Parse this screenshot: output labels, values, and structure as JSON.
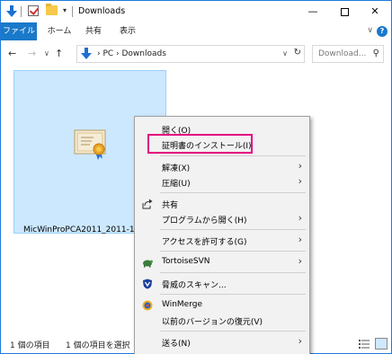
{
  "window": {
    "title": "Downloads",
    "minimize": "—",
    "close": "✕"
  },
  "ribbon": {
    "tabs": [
      "ファイル",
      "ホーム",
      "共有",
      "表示"
    ],
    "expand": "∨",
    "help": "?"
  },
  "nav": {
    "back": "←",
    "forward": "→",
    "recent": "∨",
    "up": "↑",
    "address": "›  PC  ›  Downloads",
    "address_drop": "∨",
    "refresh": "↻",
    "search_placeholder": "Download...",
    "search_icon": "⚲"
  },
  "file": {
    "name": "MicWinProPCA2011_2011-10-"
  },
  "status": {
    "count": "1 個の項目",
    "selected": "1 個の項目を選択"
  },
  "context_menu": {
    "items": [
      {
        "label": "開く(O)"
      },
      {
        "label": "証明書のインストール(I)"
      },
      {
        "label": "解凍(X)",
        "submenu": "›"
      },
      {
        "label": "圧縮(U)",
        "submenu": "›"
      },
      {
        "label": "共有",
        "icon": "share-icon"
      },
      {
        "label": "プログラムから開く(H)",
        "submenu": "›"
      },
      {
        "label": "アクセスを許可する(G)",
        "submenu": "›"
      },
      {
        "label": "TortoiseSVN",
        "icon": "tortoisesvn-icon",
        "submenu": "›"
      },
      {
        "label": "脅威のスキャン...",
        "icon": "shield-icon"
      },
      {
        "label": "WinMerge",
        "icon": "winmerge-icon"
      },
      {
        "label": "以前のバージョンの復元(V)"
      },
      {
        "label": "送る(N)",
        "submenu": "›"
      }
    ]
  },
  "colors": {
    "accent": "#1979ca",
    "selection": "#cce8ff",
    "highlight_box": "#e3007f"
  }
}
